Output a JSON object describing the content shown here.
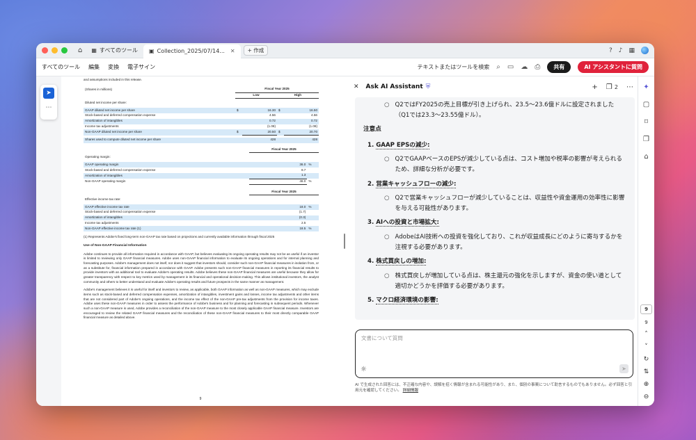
{
  "titlebar": {
    "tab_all_tools": "すべてのツール",
    "tab_file": "Collection_2025/07/14...",
    "new_tab": "+ 作成"
  },
  "toolbar": {
    "menus": [
      "すべてのツール",
      "編集",
      "変換",
      "電子サイン"
    ],
    "search_placeholder": "テキストまたはツールを検索",
    "share_label": "共有",
    "ai_label": "AI アシスタントに質問"
  },
  "doc": {
    "intro": "and assumptions included in this release.",
    "table1": {
      "unit": "(Shares in millions)",
      "header": "Fiscal Year 2025",
      "low": "Low",
      "high": "High",
      "label": "Diluted net income per share:",
      "rows": [
        {
          "name": "GAAP diluted net income per share",
          "cur1": "$",
          "low": "16.30",
          "cur2": "$",
          "high": "16.50",
          "hl": true
        },
        {
          "name": "Stock-based and deferred compensation expense",
          "cur1": "",
          "low": "4.56",
          "cur2": "",
          "high": "4.56",
          "hl": false
        },
        {
          "name": "Amortization of intangibles",
          "cur1": "",
          "low": "0.72",
          "cur2": "",
          "high": "0.72",
          "hl": true
        },
        {
          "name": "Income tax adjustments",
          "cur1": "",
          "low": "(1.08)",
          "cur2": "",
          "high": "(1.08)",
          "hl": false
        },
        {
          "name": "Non-GAAP diluted net income per share",
          "cur1": "$",
          "low": "20.50",
          "cur2": "$",
          "high": "20.70",
          "hl": true
        },
        {
          "name": "Shares used to compute diluted net income per share",
          "cur1": "",
          "low": "428",
          "cur2": "",
          "high": "428",
          "hl": true
        }
      ]
    },
    "table2": {
      "header": "Fiscal Year 2025",
      "label": "Operating margin:",
      "rows": [
        {
          "name": "GAAP operating margin",
          "val": "36.0",
          "pct": "%",
          "hl": true
        },
        {
          "name": "Stock-based and deferred compensation expense",
          "val": "8.7",
          "pct": "",
          "hl": false
        },
        {
          "name": "Amortization of intangibles",
          "val": "1.3",
          "pct": "",
          "hl": true
        },
        {
          "name": "Non-GAAP operating margin",
          "val": "46.0",
          "pct": "%",
          "hl": false
        }
      ]
    },
    "table3": {
      "header": "Fiscal Year 2025",
      "label": "Effective income tax rate:",
      "rows": [
        {
          "name": "GAAP effective income tax rate",
          "val": "18.0",
          "pct": "%",
          "hl": true
        },
        {
          "name": "Stock-based and deferred compensation expense",
          "val": "(1.7)",
          "pct": "",
          "hl": false
        },
        {
          "name": "Amortization of intangibles",
          "val": "(0.3)",
          "pct": "",
          "hl": true
        },
        {
          "name": "Income tax adjustments",
          "val": "2.5",
          "pct": "",
          "hl": false
        },
        {
          "name": "Non-GAAP effective income tax rate (1)",
          "val": "18.5",
          "pct": "%",
          "hl": true
        }
      ]
    },
    "note": "(1)  Represents Adobe's fixed long-term non-GAAP tax rate based on projections and currently available information through fiscal 2025",
    "heading": "Use of Non-GAAP Financial Information",
    "para1": "Adobe continues to provide all information required in accordance with GAAP, but believes evaluating its ongoing operating results may not be as useful if an investor is limited to reviewing only GAAP financial measures. Adobe uses non-GAAP financial information to evaluate its ongoing operations and for internal planning and forecasting purposes. Adobe's management does not itself, nor does it suggest that investors should, consider such non-GAAP financial measures in isolation from, or as a substitute for, financial information prepared in accordance with GAAP. Adobe presents such non-GAAP financial measures in reporting its financial results to provide investors with an additional tool to evaluate Adobe's operating results. Adobe believes these non-GAAP financial measures are useful because they allow for greater transparency with respect to key metrics used by management in its financial and operational decision-making. This allows institutional investors, the analyst community and others to better understand and evaluate Adobe's operating results and future prospects in the same manner as management.",
    "para2": "Adobe's management believes it is useful for itself and investors to review, as applicable, both GAAP information as well as non-GAAP measures, which may exclude items such as stock-based and deferred compensation expenses, amortization of intangibles, investment gains and losses, income tax adjustments and other items that are not considered part of Adobe's ongoing operations, and the income tax effect of the non-GAAP pre-tax adjustments from the provision for income taxes. Adobe uses these non-GAAP measures in order to assess the performance of Adobe's business and for planning and forecasting in subsequent periods. Whenever such a non-GAAP measure is used, Adobe provides a reconciliation of the non-GAAP measure to the most closely applicable GAAP financial measure. Investors are encouraged to review the related GAAP financial measures and the reconciliation of these non-GAAP financial measures to their most directly comparable GAAP financial measure as detailed above.",
    "page_number": "9"
  },
  "ai": {
    "title": "Ask AI Assistant",
    "doc_count": "2",
    "top_bullet": "Q2ではFY2025の売上目標が引き上げられ、23.5〜23.6億ドルに設定されました（Q1では23.3〜23.55億ドル）。",
    "section": "注意点",
    "items": [
      {
        "num": "1.",
        "title": "GAAP EPSの減少:",
        "bullet": "Q2でGAAPベースのEPSが減少している点は、コスト増加や税率の影響が考えられるため、詳細な分析が必要です。"
      },
      {
        "num": "2.",
        "title": "営業キャッシュフローの減少:",
        "bullet": "Q2で営業キャッシュフローが減少していることは、収益性や資金運用の効率性に影響を与える可能性があります。"
      },
      {
        "num": "3.",
        "title": "AIへの投資と市場拡大:",
        "bullet": "AdobeはAI技術への投資を強化しており、これが収益成長にどのように寄与するかを注視する必要があります。"
      },
      {
        "num": "4.",
        "title": "株式買戻しの増加:",
        "bullet": "株式買戻しが増加している点は、株主還元の強化を示しますが、資金の使い道として適切かどうかを評価する必要があります。"
      },
      {
        "num": "5.",
        "title": "マクロ経済環境の影響:",
        "bullet": ""
      }
    ],
    "input_placeholder": "文書について質問",
    "disclaimer": "AI で生成された回答には、不正確な内容や、誤解を招く情報が含まれる可能性があり、また、個別の事案について助言するものでもありません。必ず回答と引用元を確認してください。",
    "disclaimer_link": "詳細情報"
  },
  "rightrail": {
    "page_current": "9",
    "page_total": "9"
  }
}
